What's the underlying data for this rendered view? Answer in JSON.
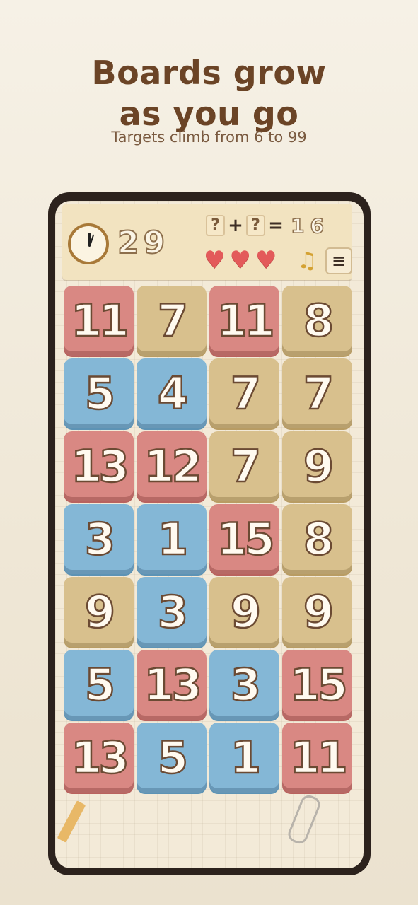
{
  "headline": {
    "line1": "Boards grow",
    "line2": "as you go",
    "subtitle": "Targets climb from 6 to 99"
  },
  "hud": {
    "timer": "29",
    "equation": {
      "slot1": "?",
      "plus": "+",
      "slot2": "?",
      "equals": "=",
      "target": "16"
    },
    "lives": 3,
    "heart_glyph": "♥",
    "music_glyph": "♫",
    "menu_glyph": "≡"
  },
  "board": {
    "columns": 4,
    "tiles": [
      {
        "value": "11",
        "color": "red"
      },
      {
        "value": "7",
        "color": "tan"
      },
      {
        "value": "11",
        "color": "red"
      },
      {
        "value": "8",
        "color": "tan"
      },
      {
        "value": "5",
        "color": "blue"
      },
      {
        "value": "4",
        "color": "blue"
      },
      {
        "value": "7",
        "color": "tan"
      },
      {
        "value": "7",
        "color": "tan"
      },
      {
        "value": "13",
        "color": "red"
      },
      {
        "value": "12",
        "color": "red"
      },
      {
        "value": "7",
        "color": "tan"
      },
      {
        "value": "9",
        "color": "tan"
      },
      {
        "value": "3",
        "color": "blue"
      },
      {
        "value": "1",
        "color": "blue"
      },
      {
        "value": "15",
        "color": "red"
      },
      {
        "value": "8",
        "color": "tan"
      },
      {
        "value": "9",
        "color": "tan"
      },
      {
        "value": "3",
        "color": "blue"
      },
      {
        "value": "9",
        "color": "tan"
      },
      {
        "value": "9",
        "color": "tan"
      },
      {
        "value": "5",
        "color": "blue"
      },
      {
        "value": "13",
        "color": "red"
      },
      {
        "value": "3",
        "color": "blue"
      },
      {
        "value": "15",
        "color": "red"
      },
      {
        "value": "13",
        "color": "red"
      },
      {
        "value": "5",
        "color": "blue"
      },
      {
        "value": "1",
        "color": "blue"
      },
      {
        "value": "11",
        "color": "red"
      }
    ]
  },
  "colors": {
    "red": "#d98883",
    "blue": "#84b7d6",
    "tan": "#d8c08d",
    "heading": "#6b4426"
  }
}
